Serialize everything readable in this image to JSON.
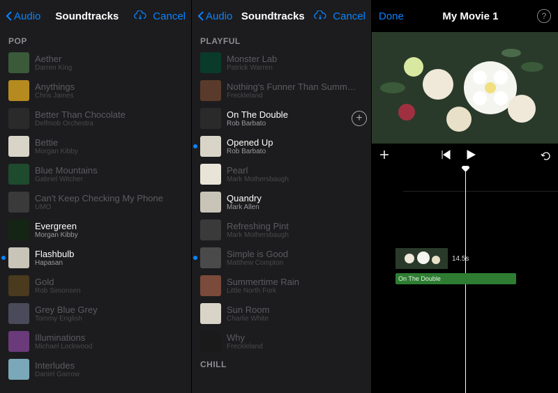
{
  "left": {
    "back_label": "Audio",
    "title": "Soundtracks",
    "cancel": "Cancel",
    "section": "POP",
    "tracks": [
      {
        "title": "Aether",
        "artist": "Darren King",
        "bright": false,
        "dot": false,
        "thumb": "#3a5a3a"
      },
      {
        "title": "Anythings",
        "artist": "Chris James",
        "bright": false,
        "dot": false,
        "thumb": "#b58a1e"
      },
      {
        "title": "Better Than Chocolate",
        "artist": "Delfmob Orchestra",
        "bright": false,
        "dot": false,
        "thumb": "#2a2a2a"
      },
      {
        "title": "Bettie",
        "artist": "Morgan Kibby",
        "bright": false,
        "dot": false,
        "thumb": "#d8d4c8"
      },
      {
        "title": "Blue Mountains",
        "artist": "Gabriel Witcher",
        "bright": false,
        "dot": false,
        "thumb": "#1e4a2e"
      },
      {
        "title": "Can't Keep Checking My Phone",
        "artist": "UMO",
        "bright": false,
        "dot": false,
        "thumb": "#3a3a3a"
      },
      {
        "title": "Evergreen",
        "artist": "Morgan Kibby",
        "bright": true,
        "dot": false,
        "thumb": "#152515"
      },
      {
        "title": "Flashbulb",
        "artist": "Hapasan",
        "bright": true,
        "dot": true,
        "thumb": "#c8c4b8"
      },
      {
        "title": "Gold",
        "artist": "Rob Simonsen",
        "bright": false,
        "dot": false,
        "thumb": "#4a3a1e"
      },
      {
        "title": "Grey Blue Grey",
        "artist": "Tommy English",
        "bright": false,
        "dot": false,
        "thumb": "#4a4a5a"
      },
      {
        "title": "Illuminations",
        "artist": "Michael Lockwood",
        "bright": false,
        "dot": false,
        "thumb": "#6a3a7a"
      },
      {
        "title": "Interludes",
        "artist": "Daniel Garrow",
        "bright": false,
        "dot": false,
        "thumb": "#7aa8b8"
      }
    ]
  },
  "mid": {
    "back_label": "Audio",
    "title": "Soundtracks",
    "cancel": "Cancel",
    "section1": "PLAYFUL",
    "section2": "CHILL",
    "tracks": [
      {
        "title": "Monster Lab",
        "artist": "Patrick Warren",
        "bright": false,
        "dot": false,
        "thumb": "#0a3a2a",
        "add": false
      },
      {
        "title": "Nothing's Funner Than Summ…",
        "artist": "Freckleland",
        "bright": false,
        "dot": false,
        "thumb": "#5a3a2a",
        "add": false
      },
      {
        "title": "On The Double",
        "artist": "Rob Barbato",
        "bright": true,
        "dot": false,
        "thumb": "#2a2a2a",
        "add": true
      },
      {
        "title": "Opened Up",
        "artist": "Rob Barbato",
        "bright": true,
        "dot": true,
        "thumb": "#d8d4c8",
        "add": false
      },
      {
        "title": "Pearl",
        "artist": "Mark Mothersbaugh",
        "bright": false,
        "dot": false,
        "thumb": "#e8e4d8",
        "add": false
      },
      {
        "title": "Quandry",
        "artist": "Mark Allen",
        "bright": true,
        "dot": false,
        "thumb": "#c8c4b8",
        "add": false
      },
      {
        "title": "Refreshing Pint",
        "artist": "Mark Mothersbaugh",
        "bright": false,
        "dot": false,
        "thumb": "#3a3a3a",
        "add": false
      },
      {
        "title": "Simple is Good",
        "artist": "Matthew Compton",
        "bright": false,
        "dot": true,
        "thumb": "#4a4a4a",
        "add": false
      },
      {
        "title": "Summertime Rain",
        "artist": "Little North Fork",
        "bright": false,
        "dot": false,
        "thumb": "#7a4a3a",
        "add": false
      },
      {
        "title": "Sun Room",
        "artist": "Charlie White",
        "bright": false,
        "dot": false,
        "thumb": "#d8d4c8",
        "add": false
      },
      {
        "title": "Why",
        "artist": "Freckleland",
        "bright": false,
        "dot": false,
        "thumb": "#1a1a1a",
        "add": false
      }
    ]
  },
  "right": {
    "done": "Done",
    "title": "My Movie 1",
    "clip_duration": "14.5s",
    "audio_clip_label": "On The Double"
  }
}
